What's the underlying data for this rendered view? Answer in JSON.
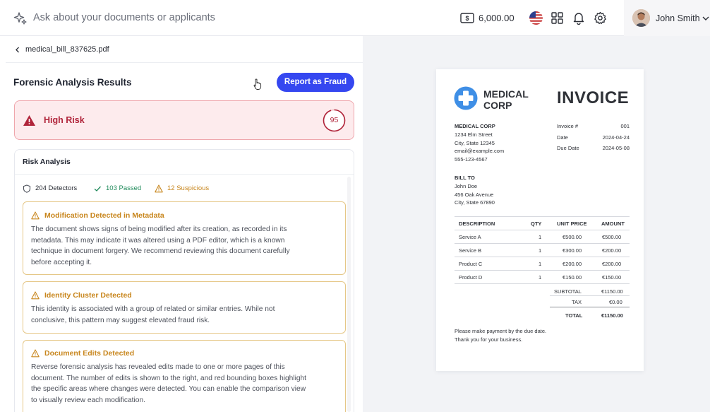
{
  "topbar": {
    "ask_placeholder": "Ask about your documents or applicants",
    "balance": "6,000.00",
    "user_name": "John Smith"
  },
  "file": {
    "name": "medical_bill_837625.pdf"
  },
  "results": {
    "title": "Forensic Analysis Results",
    "report_button": "Report as Fraud",
    "risk_label": "High Risk",
    "risk_score": "95",
    "risk_score_fraction": 0.95
  },
  "analysis": {
    "title": "Risk Analysis",
    "detectors": "204 Detectors",
    "passed": "103 Passed",
    "suspicious": "12 Suspicious",
    "cards": [
      {
        "title": "Modification Detected in Metadata",
        "lines": [
          "The document shows signs of being modified after its creation, as recorded in its",
          "metadata. This may indicate it was altered using a PDF editor, which is a known",
          "technique in document forgery. We recommend reviewing this document carefully",
          "before accepting it."
        ]
      },
      {
        "title": "Identity Cluster Detected",
        "lines": [
          "This identity is associated with a group of related or similar entries. While not",
          "conclusive, this pattern may suggest elevated fraud risk."
        ]
      },
      {
        "title": "Document Edits Detected",
        "lines": [
          "Reverse forensic analysis has revealed edits made to one or more pages of this",
          "document. The number of edits is shown to the right, and red bounding boxes highlight",
          "the specific areas where changes were detected. You can enable the comparison view",
          "to visually review each modification."
        ]
      }
    ]
  },
  "invoice": {
    "logo_line1": "MEDICAL",
    "logo_line2": "CORP",
    "heading": "INVOICE",
    "company": "MEDICAL CORP",
    "address1": "1234 Elm Street",
    "address2": "City, State 12345",
    "email": "email@example.com",
    "phone": "555-123-4567",
    "meta": [
      {
        "label": "Invoice #",
        "value": "001"
      },
      {
        "label": "Date",
        "value": "2024-04-24"
      },
      {
        "label": "Due Date",
        "value": "2024-05-08"
      }
    ],
    "bill_to_label": "BILL TO",
    "bill_name": "John Doe",
    "bill_addr1": "456 Oak Avenue",
    "bill_addr2": "City, State 67890",
    "columns": [
      "DESCRIPTION",
      "QTY",
      "UNIT PRICE",
      "AMOUNT"
    ],
    "rows": [
      {
        "desc": "Service A",
        "qty": "1",
        "price": "€500.00",
        "amount": "€500.00"
      },
      {
        "desc": "Service B",
        "qty": "1",
        "price": "€300.00",
        "amount": "€200.00"
      },
      {
        "desc": "Product C",
        "qty": "1",
        "price": "€200.00",
        "amount": "€200.00"
      },
      {
        "desc": "Product D",
        "qty": "1",
        "price": "€150.00",
        "amount": "€150.00"
      }
    ],
    "subtotal_label": "SUBTOTAL",
    "subtotal": "€1150.00",
    "tax_label": "TAX",
    "tax": "€0.00",
    "total_label": "TOTAL",
    "total": "€1150.00",
    "note1": "Please make payment by the due date.",
    "note2": "Thank you for your business."
  },
  "colors": {
    "primary_button": "#3547f0",
    "risk_red": "#b0243a",
    "warning_amber": "#c8861d",
    "passed_green": "#1f8a5a"
  },
  "icons": [
    "sparkle-icon",
    "money-icon",
    "us-flag-icon",
    "apps-grid-icon",
    "bell-icon",
    "gear-icon",
    "chevron-down-icon",
    "chevron-left-icon",
    "warning-icon",
    "shield-icon",
    "check-icon",
    "medical-cross-icon",
    "pointer-cursor-icon"
  ]
}
